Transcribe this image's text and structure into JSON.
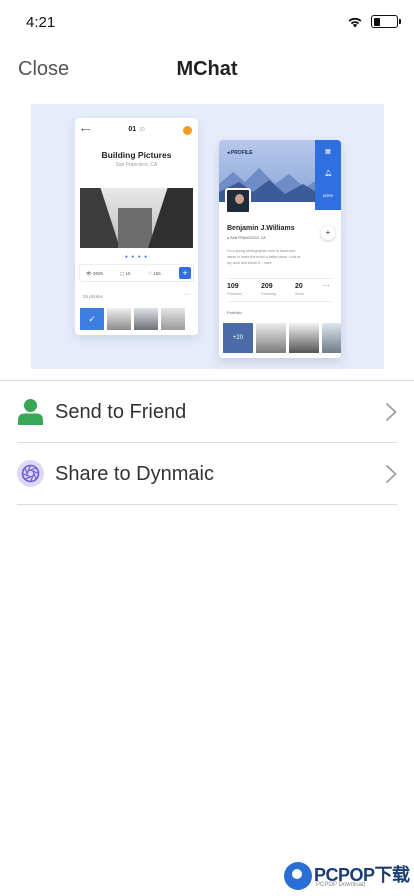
{
  "status_bar": {
    "time": "4:21",
    "battery_level": 0.3
  },
  "nav": {
    "close_label": "Close",
    "title": "MChat"
  },
  "preview": {
    "left_card": {
      "page": "01",
      "page_total": "20",
      "title": "Building Pictures",
      "subtitle": "San Francisco, CA",
      "views": "3605",
      "comments": "16",
      "likes": "156",
      "photos_label": "25 photos"
    },
    "right_card": {
      "header": "PROFILE",
      "name": "Benjamin J.Williams",
      "location": "SAN FRANCISCO, CA",
      "bio": "I'm a young photographer, love to travel and wants to make the world a better place. Look at my work and check it... more",
      "followers_value": "109",
      "followers_label": "Followers",
      "following_value": "209",
      "following_label": "Following",
      "shots_value": "20",
      "shots_label": "Shots",
      "portfolio_label": "Portfolio",
      "more_photos": "+20"
    }
  },
  "share_options": [
    {
      "label": "Send to Friend",
      "icon": "person-icon",
      "color": "#3aa757"
    },
    {
      "label": "Share to Dynmaic",
      "icon": "shutter-icon",
      "color": "#6b5bd6"
    }
  ],
  "watermark": {
    "brand": "PCPOP下载",
    "sub": "PCPOP Download"
  }
}
